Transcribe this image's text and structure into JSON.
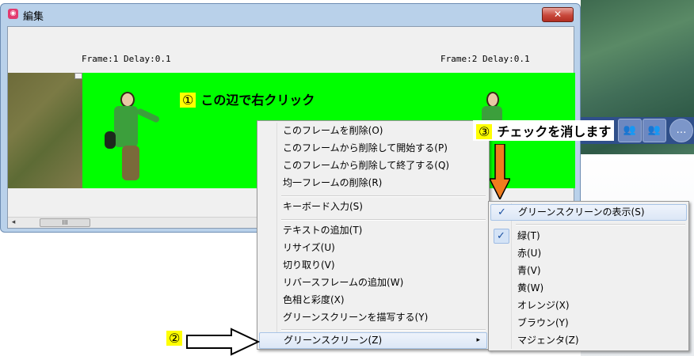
{
  "window": {
    "title": "編集",
    "close_label": "✕"
  },
  "frames": [
    {
      "label": "Frame:1  Delay:0.1"
    },
    {
      "label": "Frame:2  Delay:0.1"
    }
  ],
  "scrollbar": {
    "left_arrow": "◂",
    "right_arrow": "▸",
    "thumb_grip": "III"
  },
  "annotations": {
    "step1": {
      "num": "①",
      "text": "この辺で右クリック"
    },
    "step2": {
      "num": "②"
    },
    "step3": {
      "num": "③",
      "text": "チェックを消します"
    }
  },
  "context_menu": {
    "items": [
      "このフレームを削除(O)",
      "このフレームから削除して開始する(P)",
      "このフレームから削除して終了する(Q)",
      "均一フレームの削除(R)",
      "キーボード入力(S)",
      "テキストの追加(T)",
      "リサイズ(U)",
      "切り取り(V)",
      "リバースフレームの追加(W)",
      "色相と彩度(X)",
      "グリーンスクリーンを描写する(Y)",
      "グリーンスクリーン(Z)"
    ],
    "submenu_arrow": "▸"
  },
  "green_submenu": {
    "items": [
      {
        "label": "グリーンスクリーンの表示(S)",
        "checked": true
      },
      {
        "label": "緑(T)",
        "checked": true
      },
      {
        "label": "赤(U)",
        "checked": false
      },
      {
        "label": "青(V)",
        "checked": false
      },
      {
        "label": "黄(W)",
        "checked": false
      },
      {
        "label": "オレンジ(X)",
        "checked": false
      },
      {
        "label": "ブラウン(Y)",
        "checked": false
      },
      {
        "label": "マジェンタ(Z)",
        "checked": false
      }
    ],
    "check_glyph": "✓"
  },
  "colors": {
    "green_screen": "#00ff00",
    "arrow_orange": "#f07c1e",
    "badge_yellow": "#ffff00"
  }
}
